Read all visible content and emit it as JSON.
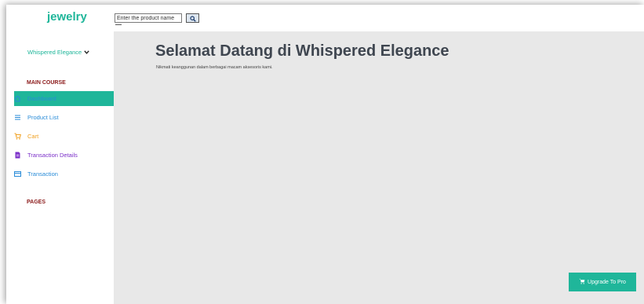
{
  "header": {
    "brand": "jewelry",
    "search_placeholder": "Enter the product name"
  },
  "sidebar": {
    "user_name": "Whispered Elegance",
    "sections": {
      "main_course": "MAIN COURSE",
      "pages": "PAGES"
    },
    "items": [
      {
        "label": "Dashboard",
        "icon": "home-icon",
        "color": "#2a8cd8",
        "active": true
      },
      {
        "label": "Product List",
        "icon": "list-icon",
        "color": "#2a8cd8",
        "active": false
      },
      {
        "label": "Cart",
        "icon": "cart-icon",
        "color": "#f0a020",
        "active": false
      },
      {
        "label": "Transaction Details",
        "icon": "document-icon",
        "color": "#7b2fc9",
        "active": false
      },
      {
        "label": "Transaction",
        "icon": "card-icon",
        "color": "#2a8cd8",
        "active": false
      }
    ]
  },
  "main": {
    "title": "Selamat Datang di Whispered Elegance",
    "subtitle": "Nikmati keanggunan dalam berbagai macam aksesoris kami."
  },
  "upgrade": {
    "label": "Upgrade To Pro"
  },
  "colors": {
    "accent": "#1fb69a",
    "section_title": "#8b1a1a",
    "main_bg": "#e8e8e8"
  }
}
